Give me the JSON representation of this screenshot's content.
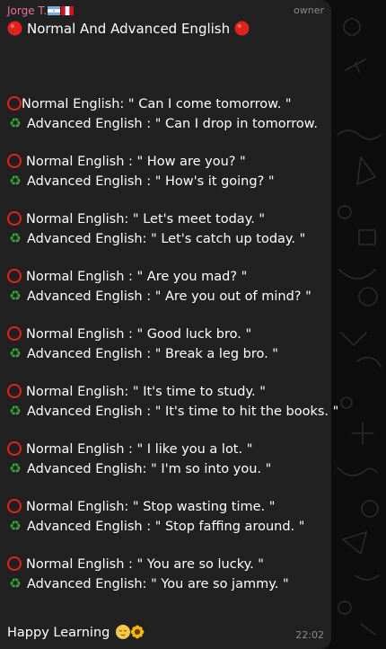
{
  "message": {
    "sender": "Jorge T.",
    "role": "owner",
    "title": "Normal And Advanced English",
    "items": [
      {
        "normal": "Normal English: \" Can I come tomorrow. \"",
        "advanced": "Advanced English : \" Can I drop in tomorrow."
      },
      {
        "normal": "Normal English : \" How are you? \"",
        "advanced": "Advanced English : \" How's it going? \""
      },
      {
        "normal": "Normal English: \" Let's meet today. \"",
        "advanced": "Advanced English: \" Let's catch up today. \""
      },
      {
        "normal": "Normal English : \" Are you mad? \"",
        "advanced": "Advanced English : \" Are you out of mind? \""
      },
      {
        "normal": "Normal English : \" Good luck bro. \"",
        "advanced": "Advanced English : \" Break a leg bro. \""
      },
      {
        "normal": "Normal English: \" It's time to study. \"",
        "advanced": "Advanced English : \" It's time to hit the books. \""
      },
      {
        "normal": "Normal English : \" I like you a lot. \"",
        "advanced": "Advanced English: \" I'm so into you. \""
      },
      {
        "normal": "Normal English: \" Stop wasting time. \"",
        "advanced": "Advanced English : \" Stop faffing around. \""
      },
      {
        "normal": "Normal English : \" You are so lucky. \"",
        "advanced": "Advanced English: \" You are so jammy. \""
      }
    ],
    "footer": "Happy Learning",
    "time": "22:02"
  },
  "colors": {
    "bubble": "#212121",
    "sender": "#e86f9c",
    "ring": "#e2221e",
    "recycle": "#3aa33a"
  },
  "icons": [
    "argentina-flag-icon",
    "peru-flag-icon",
    "red-circle-icon",
    "hollow-red-circle-icon",
    "recycle-icon",
    "relieved-face-icon",
    "sunflower-icon"
  ]
}
